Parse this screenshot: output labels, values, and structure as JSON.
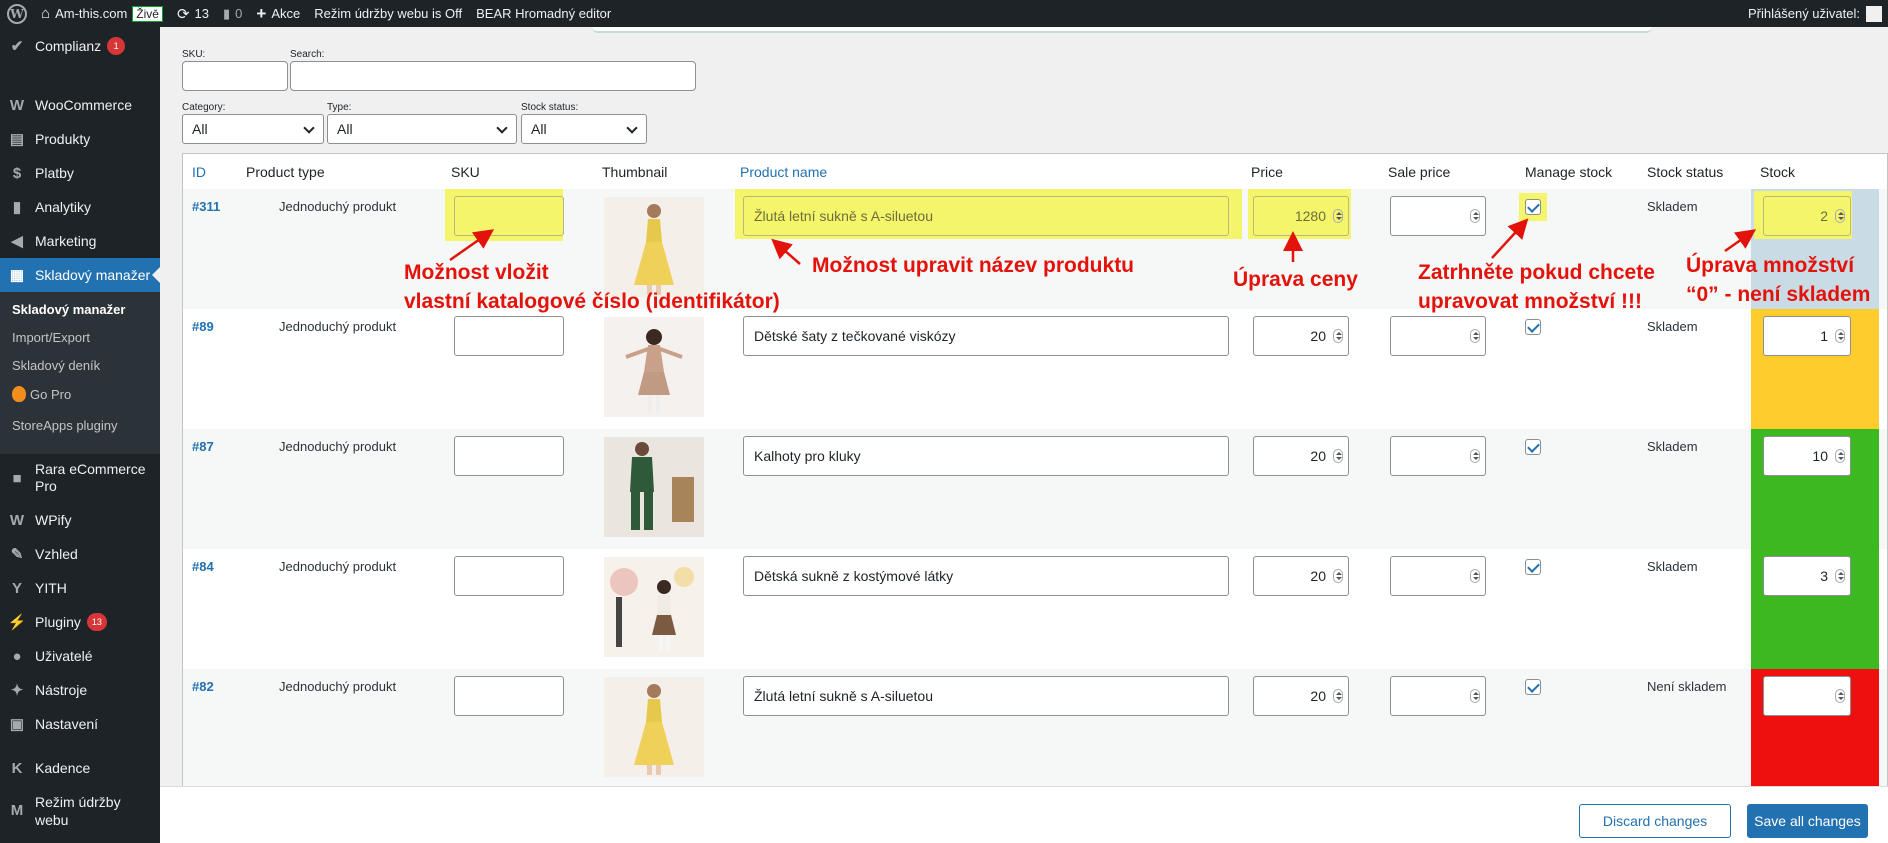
{
  "adminbar": {
    "site_name": "Am-this.com",
    "live_badge": "Živě",
    "updates_count": "13",
    "comments_count": "0",
    "new_label": "Akce",
    "maintenance_label": "Režim údržby webu is Off",
    "bulk_editor_label": "BEAR Hromadný editor",
    "user_greeting": "Přihlášený uživatel:"
  },
  "sidebar": {
    "items": [
      {
        "label": "Complianz",
        "badge": "1",
        "icon": "complianz-icon"
      },
      {
        "label": "WooCommerce",
        "icon": "woocommerce-icon"
      },
      {
        "label": "Produkty",
        "icon": "products-icon"
      },
      {
        "label": "Platby",
        "icon": "payments-icon"
      },
      {
        "label": "Analytiky",
        "icon": "analytics-icon"
      },
      {
        "label": "Marketing",
        "icon": "megaphone-icon"
      },
      {
        "label": "Skladový manažer",
        "icon": "stock-manager-icon",
        "active": true
      },
      {
        "label": "Rara eCommerce Pro",
        "icon": "rara-icon"
      },
      {
        "label": "WPify",
        "icon": "wpify-icon"
      },
      {
        "label": "Vzhled",
        "icon": "paintbrush-icon"
      },
      {
        "label": "YITH",
        "icon": "yith-icon"
      },
      {
        "label": "Pluginy",
        "badge": "13",
        "icon": "plugins-icon"
      },
      {
        "label": "Uživatelé",
        "icon": "users-icon"
      },
      {
        "label": "Nástroje",
        "icon": "tools-icon"
      },
      {
        "label": "Nastavení",
        "icon": "settings-icon"
      },
      {
        "label": "Kadence",
        "icon": "kadence-icon"
      },
      {
        "label": "Režim údržby webu",
        "icon": "maintenance-icon"
      }
    ],
    "submenu": [
      {
        "label": "Skladový manažer",
        "current": true
      },
      {
        "label": "Import/Export"
      },
      {
        "label": "Skladový deník"
      },
      {
        "label": "Go Pro"
      },
      {
        "label": "StoreApps pluginy"
      }
    ]
  },
  "filters": {
    "sku_label": "SKU:",
    "search_label": "Search:",
    "category_label": "Category:",
    "category_value": "All",
    "type_label": "Type:",
    "type_value": "All",
    "stock_status_label": "Stock status:",
    "stock_status_value": "All"
  },
  "table": {
    "headers": {
      "id": "ID",
      "product_type": "Product type",
      "sku": "SKU",
      "thumbnail": "Thumbnail",
      "product_name": "Product name",
      "price": "Price",
      "sale_price": "Sale price",
      "manage_stock": "Manage stock",
      "stock_status": "Stock status",
      "stock": "Stock"
    },
    "rows": [
      {
        "id": "#311",
        "type": "Jednoduchý produkt",
        "sku": "",
        "name": "Žlutá letní sukně s A-siluetou",
        "price": "1280",
        "sale_price": "",
        "manage_stock": true,
        "stock_status": "Skladem",
        "stock": "2",
        "stock_color": "#c9dce6",
        "thumb": "yellow-dress"
      },
      {
        "id": "#89",
        "type": "Jednoduchý produkt",
        "sku": "",
        "name": "Dětské šaty z tečkované viskózy",
        "price": "20",
        "sale_price": "",
        "manage_stock": true,
        "stock_status": "Skladem",
        "stock": "1",
        "stock_color": "#ffcc2e",
        "thumb": "girl-dress"
      },
      {
        "id": "#87",
        "type": "Jednoduchý produkt",
        "sku": "",
        "name": "Kalhoty pro kluky",
        "price": "20",
        "sale_price": "",
        "manage_stock": true,
        "stock_status": "Skladem",
        "stock": "10",
        "stock_color": "#3cb820",
        "thumb": "green-outfit"
      },
      {
        "id": "#84",
        "type": "Jednoduchý produkt",
        "sku": "",
        "name": "Dětská sukně z kostýmové látky",
        "price": "20",
        "sale_price": "",
        "manage_stock": true,
        "stock_status": "Skladem",
        "stock": "3",
        "stock_color": "#3cb820",
        "thumb": "girl-skirt"
      },
      {
        "id": "#82",
        "type": "Jednoduchý produkt",
        "sku": "",
        "name": "Žlutá letní sukně s A-siluetou",
        "price": "20",
        "sale_price": "",
        "manage_stock": true,
        "stock_status": "Není skladem",
        "stock": "",
        "stock_color": "#ee0f0f",
        "thumb": "yellow-dress"
      }
    ]
  },
  "footer": {
    "discard_label": "Discard changes",
    "save_label": "Save all changes"
  },
  "annotations": {
    "sku_line1": "Možnost vložit",
    "sku_line2": "vlastní katalogové číslo (identifikátor)",
    "name": "Možnost upravit název produktu",
    "price": "Úprava ceny",
    "manage_line1": "Zatrhněte pokud chcete",
    "manage_line2": "upravovat množství !!!",
    "stock_line1": "Úprava množství",
    "stock_line2": "“0” - není skladem"
  }
}
